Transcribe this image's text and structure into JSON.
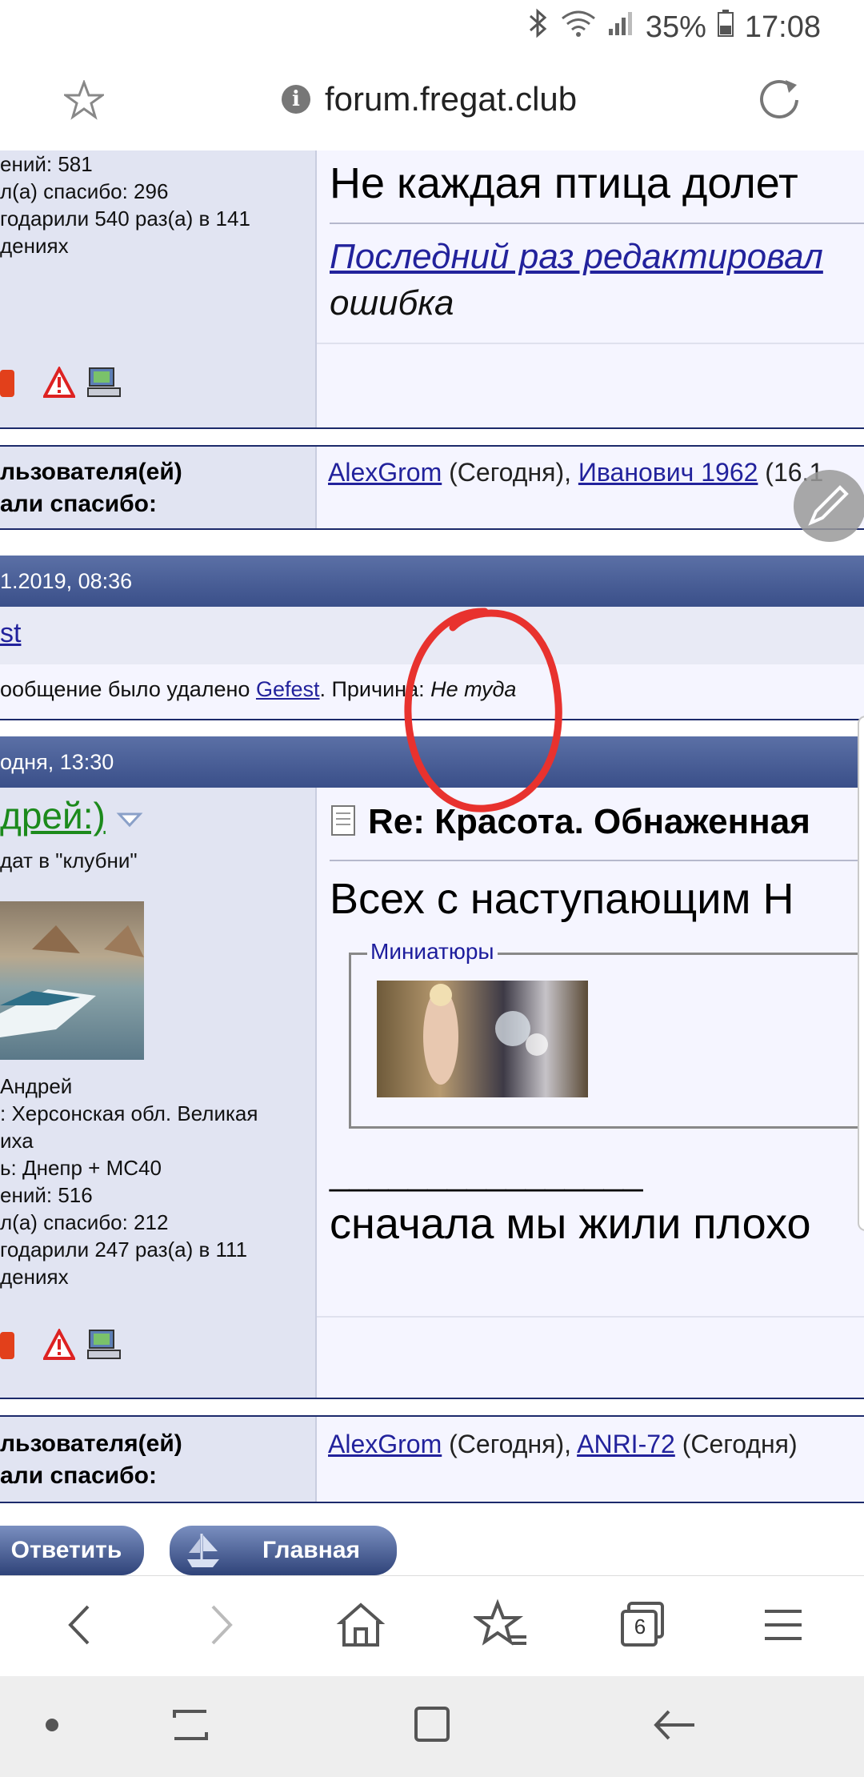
{
  "status_bar": {
    "battery": "35%",
    "time": "17:08"
  },
  "browser": {
    "url": "forum.fregat.club",
    "tabs_count": "6"
  },
  "post1": {
    "stats": [
      "ений: 581",
      "л(а) спасибо: 296",
      "годарили 540 раз(а) в 141",
      "дениях"
    ],
    "title_text": "Не каждая птица долет",
    "edit_link": "Последний раз редактировал",
    "edit_reason": "ошибка"
  },
  "thanks1": {
    "label_line1": "льзователя(ей)",
    "label_line2": "али спасибо:",
    "user1": "AlexGrom",
    "when1": " (Сегодня), ",
    "user2": "Иванович 1962",
    "when2": " (16.1"
  },
  "deleted_post": {
    "date": "1.2019, 08:36",
    "author": "st",
    "message_prefix": "ообщение было удалено ",
    "deleted_by": "Gefest",
    "reason_label": ". Причина: ",
    "reason": "Не туда"
  },
  "post2": {
    "date": "одня, 13:30",
    "username": "дрей:)",
    "user_title": "дат в \"клубни\"",
    "user_info": [
      "Андрей",
      ": Херсонская обл. Великая",
      "иха",
      "ь: Днепр + МС40",
      "ений: 516",
      "л(а) спасибо: 212",
      "годарили 247 раз(а) в 111",
      "дениях"
    ],
    "subject": "Re: Красота. Обнаженная",
    "body": "Всех с наступающим Н",
    "thumbnails_legend": "Миниатюры",
    "signature_line": "________________",
    "signature": "сначала мы жили плохо"
  },
  "thanks2": {
    "label_line1": "льзователя(ей)",
    "label_line2": "али спасибо:",
    "user1": "AlexGrom",
    "when1": " (Сегодня), ",
    "user2": "ANRI-72",
    "when2": " (Сегодня)"
  },
  "buttons": {
    "reply": "Ответить",
    "home": "Главная"
  },
  "colors": {
    "header_blue": "#3a4f89",
    "link": "#22229c",
    "annotation_red": "#e8322e"
  }
}
